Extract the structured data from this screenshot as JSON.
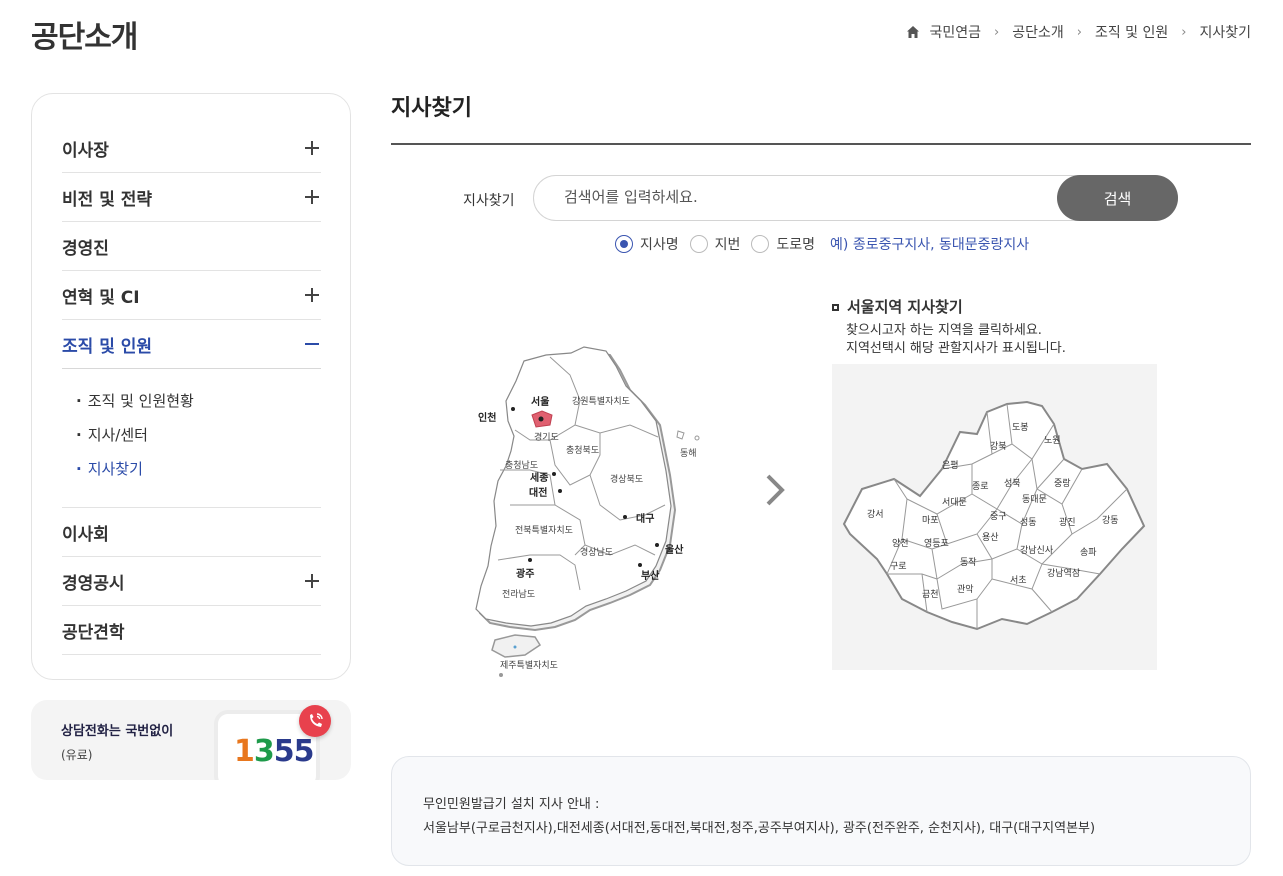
{
  "header": {
    "title": "공단소개",
    "breadcrumb": [
      "국민연금",
      "공단소개",
      "조직 및 인원",
      "지사찾기"
    ]
  },
  "sidebar": {
    "items": [
      {
        "label": "이사장",
        "toggle": "plus"
      },
      {
        "label": "비전 및 전략",
        "toggle": "plus"
      },
      {
        "label": "경영진",
        "toggle": "none"
      },
      {
        "label": "연혁 및 CI",
        "toggle": "plus"
      },
      {
        "label": "조직 및 인원",
        "toggle": "minus",
        "active": true
      },
      {
        "label": "이사회",
        "toggle": "none"
      },
      {
        "label": "경영공시",
        "toggle": "plus"
      },
      {
        "label": "공단견학",
        "toggle": "none"
      }
    ],
    "submenu": [
      "조직 및 인원현황",
      "지사/센터",
      "지사찾기"
    ],
    "submenu_current": "지사찾기"
  },
  "call": {
    "label": "상담전화는 국번없이",
    "paid": "(유료)",
    "number_parts": [
      "1",
      "3",
      "55"
    ],
    "badge_icon": "phone-icon"
  },
  "main": {
    "title": "지사찾기",
    "search": {
      "label": "지사찾기",
      "placeholder": "검색어를 입력하세요.",
      "button": "검색"
    },
    "radios": [
      "지사명",
      "지번",
      "도로명"
    ],
    "radio_selected": "지사명",
    "example": "예) 종로중구지사, 동대문중랑지사"
  },
  "korea_map": {
    "regions": [
      "강원특별자치도",
      "경기도",
      "충청북도",
      "충청남도",
      "경상북도",
      "전북특별자치도",
      "경상남도",
      "전라남도",
      "제주특별자치도"
    ],
    "cities": [
      "서울",
      "인천",
      "세종",
      "대전",
      "대구",
      "울산",
      "부산",
      "광주"
    ],
    "sea_label": "동해",
    "selected": "서울"
  },
  "seoul": {
    "heading": "서울지역 지사찾기",
    "desc1": "찾으시고자 하는 지역을 클릭하세요.",
    "desc2": "지역선택시 해당 관할지사가 표시됩니다.",
    "districts": [
      "도봉",
      "노원",
      "강북",
      "은평",
      "성북",
      "중랑",
      "종로",
      "동대문",
      "서대문",
      "강서",
      "마포",
      "중구",
      "성동",
      "광진",
      "강동",
      "양천",
      "영등포",
      "용산",
      "강남신사",
      "송파",
      "구로",
      "동작",
      "강남역삼",
      "서초",
      "금천",
      "관악"
    ]
  },
  "notice": {
    "line1": "무인민원발급기 설치 지사 안내 :",
    "line2": "서울남부(구로금천지사),대전세종(서대전,동대전,북대전,청주,공주부여지사), 광주(전주완주, 순천지사), 대구(대구지역본부)"
  }
}
